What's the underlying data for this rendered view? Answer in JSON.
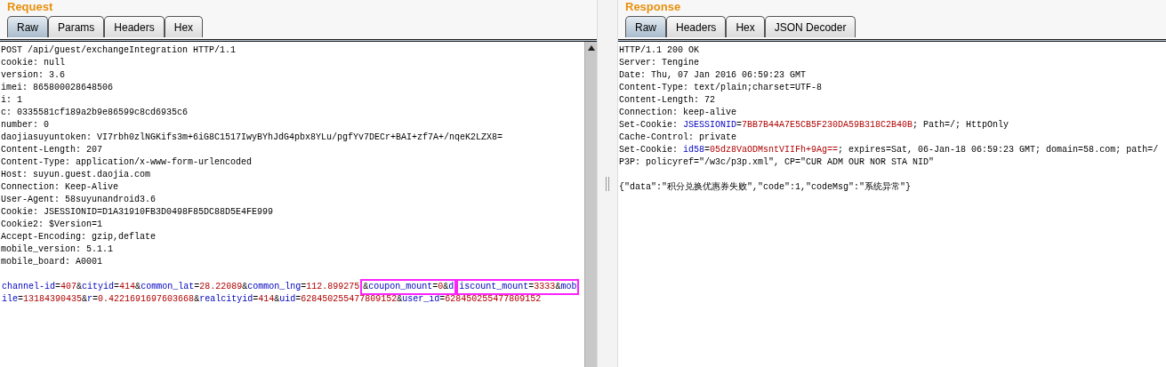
{
  "request": {
    "title": "Request",
    "tabs": [
      {
        "label": "Raw",
        "selected": true
      },
      {
        "label": "Params",
        "selected": false
      },
      {
        "label": "Headers",
        "selected": false
      },
      {
        "label": "Hex",
        "selected": false
      }
    ],
    "lines": [
      "POST /api/guest/exchangeIntegration HTTP/1.1",
      "cookie: null",
      "version: 3.6",
      "imei: 865800028648506",
      "i: 1",
      "c: 0335581cf189a2b9e86599c8cd6935c6",
      "number: 0",
      "daojiasuyuntoken: VI7rbh0zlNGKifs3m+6iG8C1517IwyBYhJdG4pbx8YLu/pgfYv7DECr+BAI+zf7A+/nqeK2LZX8=",
      "Content-Length: 207",
      "Content-Type: application/x-www-form-urlencoded",
      "Host: suyun.guest.daojia.com",
      "Connection: Keep-Alive",
      "User-Agent: 58suyunandroid3.6",
      "Cookie: JSESSIONID=D1A31910FB3D0498F85DC88D5E4FE999",
      "Cookie2: $Version=1",
      "Accept-Encoding: gzip,deflate",
      "mobile_version: 5.1.1",
      "mobile_board: A0001"
    ],
    "body": [
      {
        "runs": [
          {
            "boxed": false,
            "segments": [
              {
                "kind": "key",
                "text": "channel-id"
              },
              {
                "kind": "sep",
                "text": "="
              },
              {
                "kind": "value",
                "text": "407"
              },
              {
                "kind": "sep",
                "text": "&"
              },
              {
                "kind": "key",
                "text": "cityid"
              },
              {
                "kind": "sep",
                "text": "="
              },
              {
                "kind": "value",
                "text": "414"
              },
              {
                "kind": "sep",
                "text": "&"
              },
              {
                "kind": "key",
                "text": "common_lat"
              },
              {
                "kind": "sep",
                "text": "="
              },
              {
                "kind": "value",
                "text": "28.22089"
              },
              {
                "kind": "sep",
                "text": "&"
              },
              {
                "kind": "key",
                "text": "common_lng"
              },
              {
                "kind": "sep",
                "text": "="
              },
              {
                "kind": "value",
                "text": "112.899275"
              }
            ]
          },
          {
            "boxed": true,
            "segments": [
              {
                "kind": "sep",
                "text": "&"
              },
              {
                "kind": "key",
                "text": "coupon_mount"
              },
              {
                "kind": "sep",
                "text": "="
              },
              {
                "kind": "value",
                "text": "0"
              },
              {
                "kind": "sep",
                "text": "&"
              },
              {
                "kind": "key",
                "text": "d"
              }
            ]
          },
          {
            "boxed": true,
            "segments": [
              {
                "kind": "key",
                "text": "iscount_mount"
              },
              {
                "kind": "sep",
                "text": "="
              },
              {
                "kind": "value",
                "text": "3333"
              },
              {
                "kind": "sep",
                "text": "&"
              },
              {
                "kind": "key",
                "text": "mob"
              }
            ]
          }
        ]
      },
      {
        "runs": [
          {
            "boxed": false,
            "segments": [
              {
                "kind": "key",
                "text": "ile"
              },
              {
                "kind": "sep",
                "text": "="
              },
              {
                "kind": "value",
                "text": "13184390435"
              },
              {
                "kind": "sep",
                "text": "&"
              },
              {
                "kind": "key",
                "text": "r"
              },
              {
                "kind": "sep",
                "text": "="
              },
              {
                "kind": "value",
                "text": "0.4221691697603668"
              },
              {
                "kind": "sep",
                "text": "&"
              },
              {
                "kind": "key",
                "text": "realcityid"
              },
              {
                "kind": "sep",
                "text": "="
              },
              {
                "kind": "value",
                "text": "414"
              },
              {
                "kind": "sep",
                "text": "&"
              },
              {
                "kind": "key",
                "text": "uid"
              },
              {
                "kind": "sep",
                "text": "="
              },
              {
                "kind": "value",
                "text": "628450255477809152"
              },
              {
                "kind": "sep",
                "text": "&"
              },
              {
                "kind": "key",
                "text": "user_id"
              },
              {
                "kind": "sep",
                "text": "="
              },
              {
                "kind": "value",
                "text": "628450255477809152"
              }
            ]
          }
        ]
      }
    ]
  },
  "response": {
    "title": "Response",
    "tabs": [
      {
        "label": "Raw",
        "selected": true
      },
      {
        "label": "Headers",
        "selected": false
      },
      {
        "label": "Hex",
        "selected": false
      },
      {
        "label": "JSON Decoder",
        "selected": false
      }
    ],
    "lines": [
      [
        {
          "kind": "sep",
          "text": "HTTP/1.1 200 OK"
        }
      ],
      [
        {
          "kind": "sep",
          "text": "Server: Tengine"
        }
      ],
      [
        {
          "kind": "sep",
          "text": "Date: Thu, 07 Jan 2016 06:59:23 GMT"
        }
      ],
      [
        {
          "kind": "sep",
          "text": "Content-Type: text/plain;charset=UTF-8"
        }
      ],
      [
        {
          "kind": "sep",
          "text": "Content-Length: 72"
        }
      ],
      [
        {
          "kind": "sep",
          "text": "Connection: keep-alive"
        }
      ],
      [
        {
          "kind": "sep",
          "text": "Set-Cookie: "
        },
        {
          "kind": "key",
          "text": "JSESSIONID"
        },
        {
          "kind": "sep",
          "text": "="
        },
        {
          "kind": "value",
          "text": "7BB7B44A7E5CB5F230DA59B318C2B40B"
        },
        {
          "kind": "sep",
          "text": "; Path=/; HttpOnly"
        }
      ],
      [
        {
          "kind": "sep",
          "text": "Cache-Control: private"
        }
      ],
      [
        {
          "kind": "sep",
          "text": "Set-Cookie: "
        },
        {
          "kind": "key",
          "text": "id58"
        },
        {
          "kind": "sep",
          "text": "="
        },
        {
          "kind": "value",
          "text": "05dz8VaODMsntVIIFh+9Ag=="
        },
        {
          "kind": "sep",
          "text": "; expires=Sat, 06-Jan-18 06:59:23 GMT; domain=58.com; path=/"
        }
      ],
      [
        {
          "kind": "sep",
          "text": "P3P: policyref=\"/w3c/p3p.xml\", CP=\"CUR ADM OUR NOR STA NID\""
        }
      ]
    ],
    "body_text": "{\"data\":\"积分兑换优惠券失败\",\"code\":1,\"codeMsg\":\"系统异常\"}"
  }
}
